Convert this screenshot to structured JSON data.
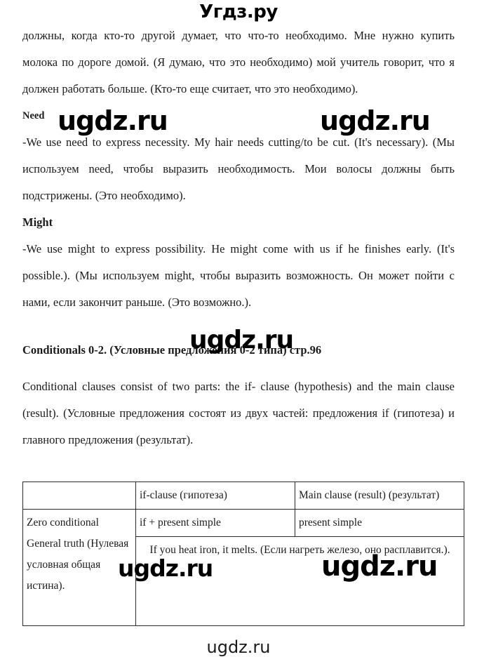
{
  "site": {
    "logo_text": "Угдз.ру",
    "watermark_text": "ugdz.ru",
    "footer_text": "ugdz.ru"
  },
  "document": {
    "intro_paragraph": "должны, когда кто-то другой думает, что что-то необходимо. Мне нужно купить молока по дороге домой. (Я думаю, что это необходимо) мой учитель говорит, что я должен работать больше. (Кто-то еще считает, что это необходимо).",
    "sections": [
      {
        "heading": "Need",
        "body": "-We use need to express necessity. My hair needs cutting/to be cut. (It's necessary). (Мы используем need, чтобы выразить необходимость. Мои волосы должны быть подстрижены. (Это необходимо)."
      },
      {
        "heading": "Might",
        "body": "-We use might to express possibility. He might come with us if he finishes early. (It's possible.). (Мы используем might, чтобы выразить возможность. Он может пойти с нами, если закончит раньше. (Это возможно.)."
      }
    ],
    "topic_heading": "Conditionals 0-2. (Условные предложения 0-2 типа) стр.96",
    "topic_paragraph": "Conditional clauses consist of two parts: the if- clause (hypothesis) and the main clause (result). (Условные предложения состоят из двух частей: предложения if (гипотеза) и главного предложения (результат)."
  },
  "table": {
    "corner_label": "",
    "headers": [
      "if-clause (гипотеза)",
      "Main clause (result) (результат)"
    ],
    "rows": [
      {
        "label": "Zero conditional General truth (Нулевая условная общая истина).",
        "if_clause": "if + present simple",
        "main_clause": "present simple",
        "example": "If you heat iron, it melts. (Если нагреть железо, оно расплавится.)."
      }
    ]
  }
}
